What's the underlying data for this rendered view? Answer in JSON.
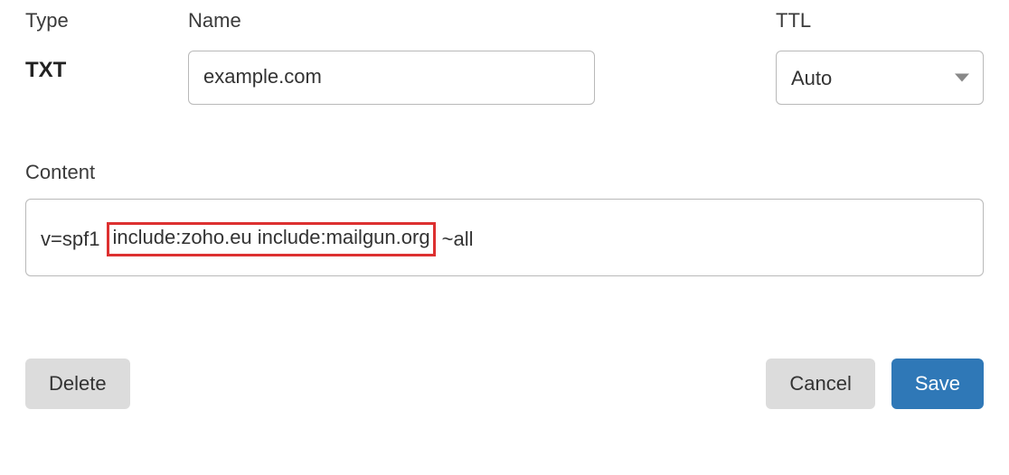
{
  "labels": {
    "type": "Type",
    "name": "Name",
    "ttl": "TTL",
    "content": "Content"
  },
  "record": {
    "type": "TXT",
    "name": "example.com",
    "ttl_selected": "Auto",
    "content_full": "v=spf1 include:zoho.eu include:mailgun.org ~all",
    "content_prefix": "v=spf1 ",
    "content_highlighted": "include:zoho.eu include:mailgun.org",
    "content_suffix": " ~all"
  },
  "buttons": {
    "delete": "Delete",
    "cancel": "Cancel",
    "save": "Save"
  }
}
